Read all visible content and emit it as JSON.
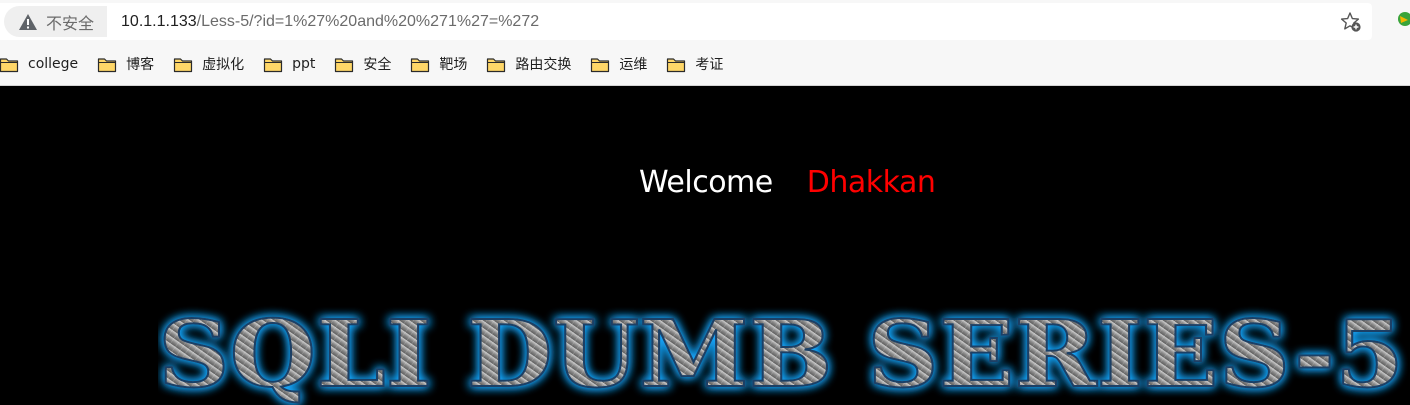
{
  "browser": {
    "security_label": "不安全",
    "url_host": "10.1.1.133",
    "url_path": "/Less-5/?id=1%27%20and%20%271%27=%272"
  },
  "bookmarks": [
    {
      "label": "college"
    },
    {
      "label": "博客"
    },
    {
      "label": "虚拟化"
    },
    {
      "label": "ppt"
    },
    {
      "label": "安全"
    },
    {
      "label": "靶场"
    },
    {
      "label": "路由交换"
    },
    {
      "label": "运维"
    },
    {
      "label": "考证"
    }
  ],
  "page": {
    "welcome_text": "Welcome",
    "user_name": "Dhakkan",
    "banner_title": "SQLI DUMB SERIES-5"
  },
  "colors": {
    "page_bg": "#000000",
    "user_name": "#ff0000",
    "banner_glow": "#1aa8ff"
  }
}
